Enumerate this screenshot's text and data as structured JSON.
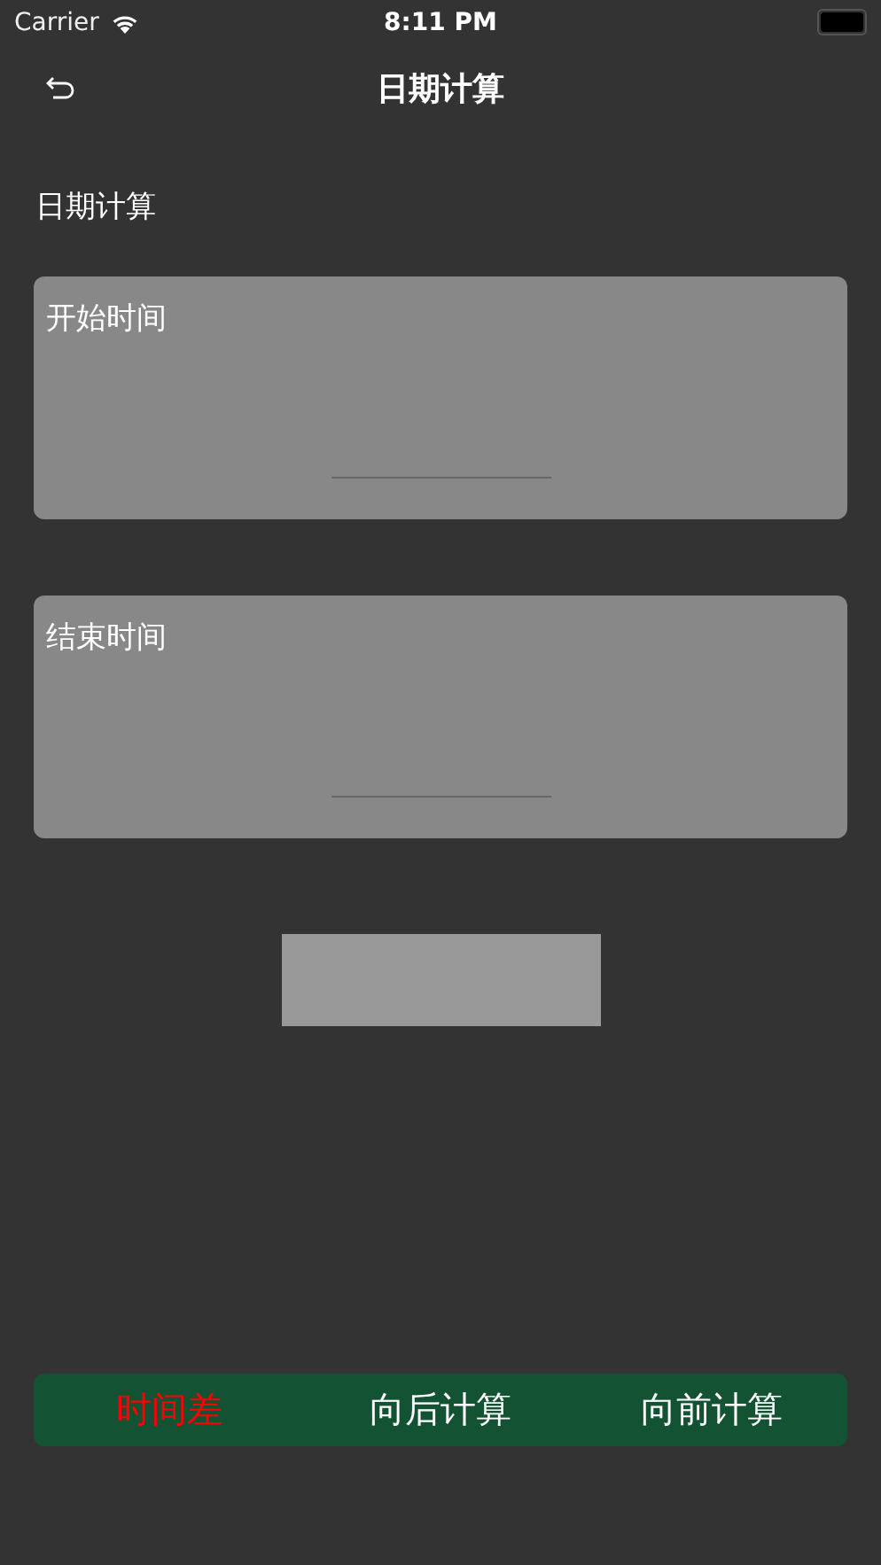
{
  "status_bar": {
    "carrier": "Carrier",
    "time": "8:11 PM"
  },
  "nav": {
    "title": "日期计算"
  },
  "section_title": "日期计算",
  "date_cards": [
    {
      "label": "开始时间"
    },
    {
      "label": "结束时间"
    }
  ],
  "tabs": [
    {
      "label": "时间差",
      "selected": true
    },
    {
      "label": "向后计算",
      "selected": false
    },
    {
      "label": "向前计算",
      "selected": false
    }
  ]
}
